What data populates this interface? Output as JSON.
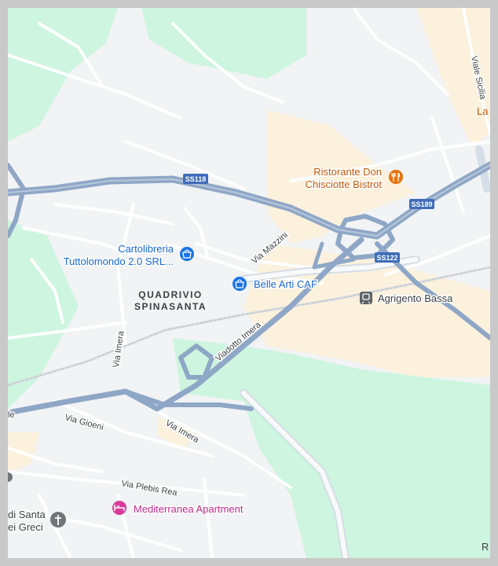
{
  "map": {
    "area_labels": {
      "quadrivio_line1": "QUADRIVIO",
      "quadrivio_line2": "SPINASANTA"
    },
    "roads": {
      "viale_sicilia": "Viale Sicilia",
      "via_mazzini": "Via Mazzini",
      "viadotto_imera": "Viadotto Imera",
      "via_imera_upper": "Via Imera",
      "via_imera_lower": "Via Imera",
      "via_gioeni": "Via Gioeni",
      "via_plebis_rea": "Via Plebis Rea",
      "left_edge_fragment": "le"
    },
    "shields": {
      "ss118": "SS118",
      "ss189": "SS189",
      "ss122": "SS122"
    },
    "pois": {
      "ristorante_line1": "Ristorante Don",
      "ristorante_line2": "Chisciotte Bistrot",
      "cartolibreria_line1": "Cartolibreria",
      "cartolibreria_line2": "Tuttolomondo 2.0 SRL...",
      "belle_arti": "Belle Arti CAF",
      "agrigento_bassa": "Agrigento Bassa",
      "mediterranea": "Mediterranea Apartment",
      "church_line1": "di Santa",
      "church_line2": "ei Greci",
      "top_right_fragment": "La",
      "bottom_right_fragment": "R"
    },
    "colors": {
      "background": "#f1f3f4",
      "park": "#cdf5df",
      "sand": "#fbf1dd",
      "highway": "#8fa7c6",
      "street": "#ffffff",
      "restaurant": "#e8710a",
      "shop": "#1a73e8",
      "lodging": "#d93b9c",
      "transit": "#5f6368",
      "label": "#3c4043"
    },
    "icons": [
      "fork-knife-icon",
      "shopping-bag-icon",
      "train-icon",
      "bed-icon",
      "cross-icon"
    ]
  }
}
